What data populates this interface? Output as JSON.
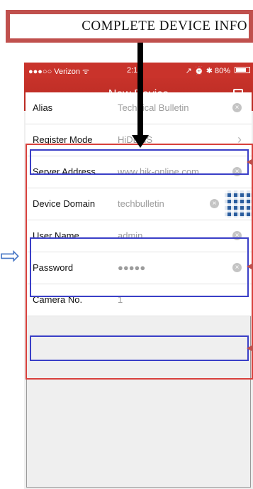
{
  "banner": {
    "text": "COMPLETE DEVICE INFO"
  },
  "status_bar": {
    "carrier": "●●●○○ Verizon ᯤ",
    "time": "2:14",
    "right": "↗ ⏰ ✱ 80%",
    "battery_level": 0.8
  },
  "nav": {
    "back_icon": "←",
    "title": "New Device"
  },
  "form": {
    "rows": [
      {
        "label": "Alias",
        "value": "Technical Bulletin",
        "clear": "⊗"
      },
      {
        "label": "Register Mode",
        "value": "HiDDNS",
        "chevron": "›"
      },
      {
        "label": "Server Address",
        "value": "www.hik-online.com",
        "clear": "⊗"
      },
      {
        "label": "Device Domain",
        "value": "techbulletin",
        "clear": "⊗"
      },
      {
        "label": "User Name",
        "value": "admin",
        "clear": "⊗"
      },
      {
        "label": "Password",
        "value": "●●●●●",
        "clear": "⊗"
      },
      {
        "label": "Camera No.",
        "value": "1"
      }
    ]
  },
  "colors": {
    "accent": "#c9332b",
    "annotation_red": "#d8403c",
    "annotation_blue": "#3a3fc7"
  },
  "icons": {
    "side_arrow": "⇨"
  }
}
